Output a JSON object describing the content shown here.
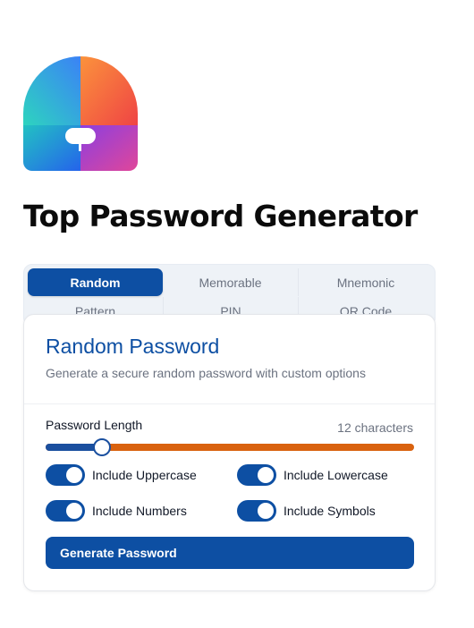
{
  "app": {
    "title": "Top Password Generator"
  },
  "tabs": [
    {
      "label": "Random",
      "active": true
    },
    {
      "label": "Memorable",
      "active": false
    },
    {
      "label": "Mnemonic",
      "active": false
    },
    {
      "label": "Pattern",
      "active": false
    },
    {
      "label": "PIN",
      "active": false
    },
    {
      "label": "QR Code",
      "active": false
    }
  ],
  "card": {
    "title": "Random Password",
    "description": "Generate a secure random password with custom options",
    "length_label": "Password Length",
    "length_value_text": "12 characters",
    "length_fraction": 0.152
  },
  "options": [
    {
      "label": "Include Uppercase",
      "checked": true
    },
    {
      "label": "Include Lowercase",
      "checked": true
    },
    {
      "label": "Include Numbers",
      "checked": true
    },
    {
      "label": "Include Symbols",
      "checked": true
    }
  ],
  "generate_label": "Generate Password",
  "colors": {
    "primary": "#0d4fa3",
    "slider_remaining": "#d9620f",
    "logo_teal": "#2dd4bf",
    "logo_blue": "#2f6fe6",
    "logo_orange": "#f97316",
    "logo_red": "#ef4444",
    "logo_purple": "#a03ad6",
    "logo_pink": "#d946b4"
  },
  "icons": {
    "logo": "keyhole-shield-logo-icon"
  }
}
